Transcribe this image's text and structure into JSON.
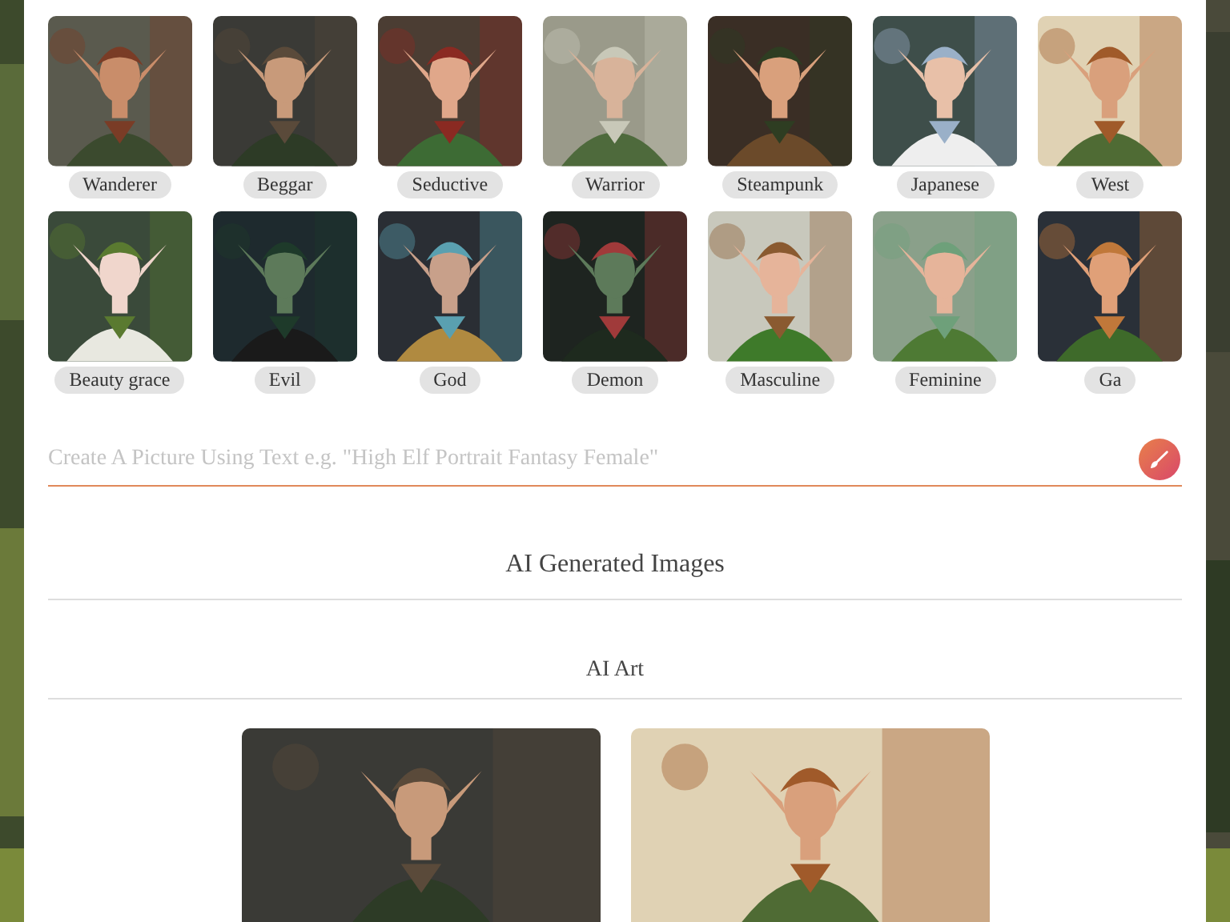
{
  "styles": [
    {
      "label": "Wanderer"
    },
    {
      "label": "Beggar"
    },
    {
      "label": "Seductive"
    },
    {
      "label": "Warrior"
    },
    {
      "label": "Steampunk"
    },
    {
      "label": "Japanese"
    },
    {
      "label": "West"
    }
  ],
  "styles_row_2": [
    {
      "label": "Beauty grace"
    },
    {
      "label": "Evil"
    },
    {
      "label": "God"
    },
    {
      "label": "Demon"
    },
    {
      "label": "Masculine"
    },
    {
      "label": "Feminine"
    },
    {
      "label": "Ga"
    }
  ],
  "prompt": {
    "placeholder": "Create A Picture Using Text e.g. \"High Elf Portrait Fantasy Female\""
  },
  "sections": [
    {
      "title": "AI Generated Images"
    },
    {
      "title": "AI Art"
    }
  ]
}
